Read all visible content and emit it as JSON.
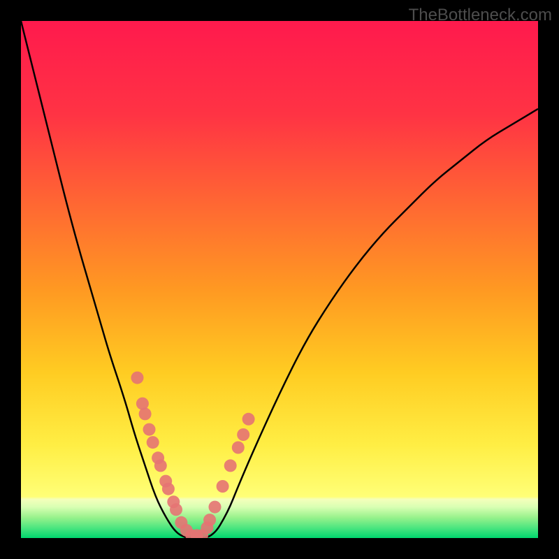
{
  "watermark": "TheBottleneck.com",
  "colors": {
    "bg": "#000000",
    "gradient_top": "#ff1744",
    "gradient_mid1": "#ff5733",
    "gradient_mid2": "#ffa500",
    "gradient_mid3": "#ffd700",
    "gradient_bottom": "#ffff66",
    "green_light": "#e8ffcc",
    "green_mid": "#aaff7f",
    "green_bright": "#00e676",
    "curve": "#000000",
    "dots": "#e57373",
    "watermark_color": "#4d4d4d"
  },
  "chart_data": {
    "type": "line",
    "title": "",
    "xlabel": "",
    "ylabel": "",
    "xlim": [
      0,
      100
    ],
    "ylim": [
      0,
      100
    ],
    "series": [
      {
        "name": "bottleneck-curve",
        "x": [
          0,
          5,
          10,
          15,
          17,
          20,
          22,
          24,
          26,
          28,
          30,
          32,
          33,
          37,
          40,
          42,
          45,
          50,
          55,
          60,
          65,
          70,
          75,
          80,
          85,
          90,
          95,
          100
        ],
        "y": [
          100,
          80,
          60,
          43,
          36,
          27,
          20,
          14,
          8,
          4,
          1,
          0,
          0,
          0,
          5,
          10,
          17,
          28,
          38,
          46,
          53,
          59,
          64,
          69,
          73,
          77,
          80,
          83
        ]
      }
    ],
    "scatter_points": {
      "name": "highlighted-points",
      "x": [
        22.5,
        23.5,
        24,
        24.8,
        25.5,
        26.5,
        27,
        28,
        28.5,
        29.5,
        30,
        31,
        32,
        33,
        34,
        35,
        36,
        36.5,
        37.5,
        39,
        40.5,
        42,
        43,
        44
      ],
      "y": [
        31,
        26,
        24,
        21,
        18.5,
        15.5,
        14,
        11,
        9.5,
        7,
        5.5,
        3,
        1.5,
        0.5,
        0.5,
        0.5,
        2,
        3.5,
        6,
        10,
        14,
        17.5,
        20,
        23
      ]
    },
    "green_zone": {
      "start_pct": 92,
      "end_pct": 100
    },
    "minimum_x": 33
  }
}
